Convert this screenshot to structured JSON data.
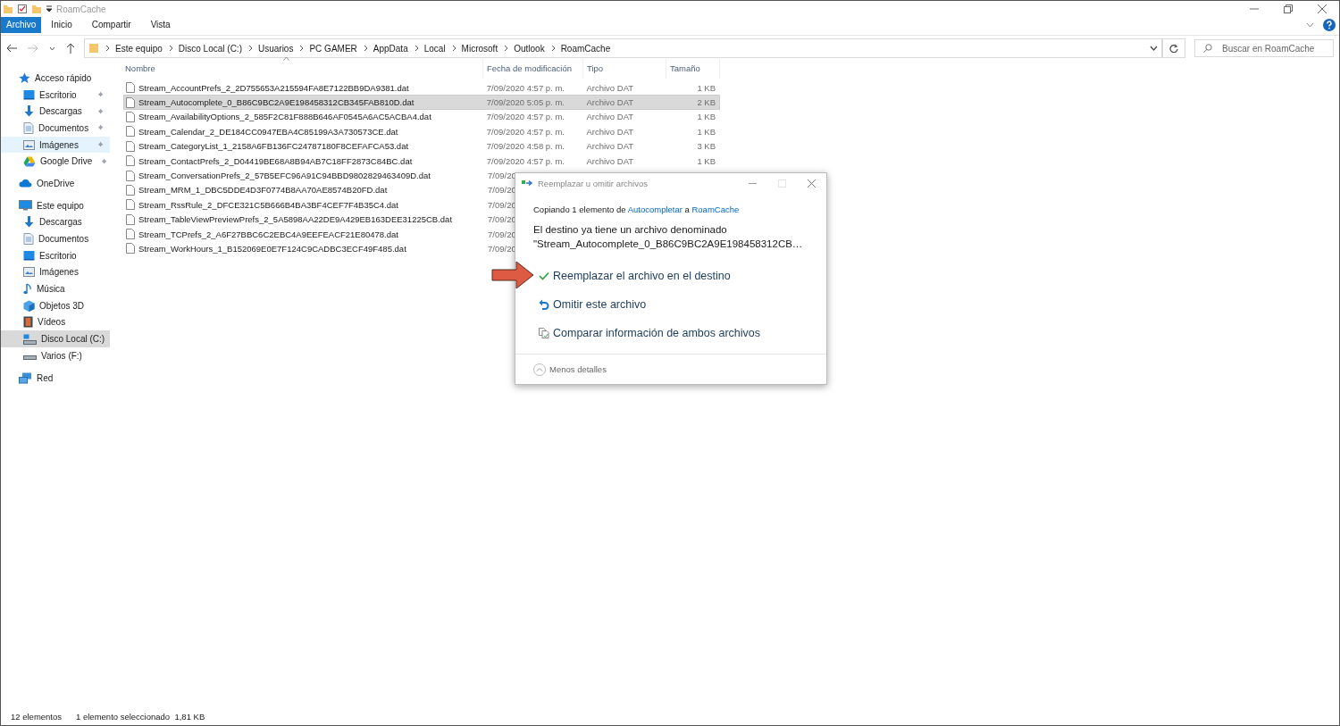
{
  "window": {
    "title": "RoamCache"
  },
  "ribbon": {
    "tabs": [
      {
        "label": "Archivo",
        "selected": true
      },
      {
        "label": "Inicio",
        "selected": false
      },
      {
        "label": "Compartir",
        "selected": false
      },
      {
        "label": "Vista",
        "selected": false
      }
    ]
  },
  "address": {
    "crumbs": [
      "Este equipo",
      "Disco Local (C:)",
      "Usuarios",
      "PC GAMER",
      "AppData",
      "Local",
      "Microsoft",
      "Outlook",
      "RoamCache"
    ],
    "search_placeholder": "Buscar en RoamCache"
  },
  "sidebar": {
    "items": [
      {
        "label": "Acceso rápido",
        "kind": "star",
        "selected": false,
        "hovered": false,
        "children": [
          {
            "label": "Escritorio",
            "kind": "desktop",
            "selected": false,
            "hovered": false,
            "pinned": true
          },
          {
            "label": "Descargas",
            "kind": "download",
            "selected": false,
            "hovered": false,
            "pinned": true
          },
          {
            "label": "Documentos",
            "kind": "document",
            "selected": false,
            "hovered": false,
            "pinned": true
          },
          {
            "label": "Imágenes",
            "kind": "pictures",
            "selected": false,
            "hovered": true,
            "pinned": true
          },
          {
            "label": "Google Drive",
            "kind": "gdrive",
            "selected": false,
            "hovered": false,
            "pinned": true
          }
        ]
      },
      {
        "label": "OneDrive",
        "kind": "cloud",
        "selected": false,
        "hovered": false
      },
      {
        "label": "Este equipo",
        "kind": "computer",
        "selected": false,
        "hovered": false,
        "children": [
          {
            "label": "Descargas",
            "kind": "download",
            "selected": false,
            "hovered": false
          },
          {
            "label": "Documentos",
            "kind": "document",
            "selected": false,
            "hovered": false
          },
          {
            "label": "Escritorio",
            "kind": "desktop",
            "selected": false,
            "hovered": false
          },
          {
            "label": "Imágenes",
            "kind": "pictures",
            "selected": false,
            "hovered": false
          },
          {
            "label": "Música",
            "kind": "music",
            "selected": false,
            "hovered": false
          },
          {
            "label": "Objetos 3D",
            "kind": "cube",
            "selected": false,
            "hovered": false
          },
          {
            "label": "Vídeos",
            "kind": "video",
            "selected": false,
            "hovered": false
          },
          {
            "label": "Disco Local (C:)",
            "kind": "disk",
            "selected": true,
            "hovered": false
          },
          {
            "label": "Varios (F:)",
            "kind": "drive",
            "selected": false,
            "hovered": false
          }
        ]
      },
      {
        "label": "Red",
        "kind": "network",
        "selected": false,
        "hovered": false
      }
    ]
  },
  "file_list": {
    "columns": [
      "Nombre",
      "Fecha de modificación",
      "Tipo",
      "Tamaño"
    ],
    "rows": [
      {
        "name": "Stream_AccountPrefs_2_2D755653A215594FA8E7122BB9DA9381.dat",
        "date": "7/09/2020 4:57 p. m.",
        "type": "Archivo DAT",
        "size": "1 KB",
        "selected": false
      },
      {
        "name": "Stream_Autocomplete_0_B86C9BC2A9E198458312CB345FAB810D.dat",
        "date": "7/09/2020 5:05 p. m.",
        "type": "Archivo DAT",
        "size": "2 KB",
        "selected": true
      },
      {
        "name": "Stream_AvailabilityOptions_2_585F2C81F888B646AF0545A6AC5ACBA4.dat",
        "date": "7/09/2020 4:57 p. m.",
        "type": "Archivo DAT",
        "size": "1 KB",
        "selected": false
      },
      {
        "name": "Stream_Calendar_2_DE184CC0947EBA4C85199A3A730573CE.dat",
        "date": "7/09/2020 4:57 p. m.",
        "type": "Archivo DAT",
        "size": "1 KB",
        "selected": false
      },
      {
        "name": "Stream_CategoryList_1_2158A6FB136FC24787180F8CEFAFCA53.dat",
        "date": "7/09/2020 4:58 p. m.",
        "type": "Archivo DAT",
        "size": "3 KB",
        "selected": false
      },
      {
        "name": "Stream_ContactPrefs_2_D04419BE68A8B94AB7C18FF2873C84BC.dat",
        "date": "7/09/2020 4:57 p. m.",
        "type": "Archivo DAT",
        "size": "1 KB",
        "selected": false
      },
      {
        "name": "Stream_ConversationPrefs_2_57B5EFC96A91C94BBD9802829463409D.dat",
        "date": "7/09/20",
        "selected": false
      },
      {
        "name": "Stream_MRM_1_DBC5DDE4D3F0774B8AA70AE8574B20FD.dat",
        "date": "7/09/20",
        "selected": false
      },
      {
        "name": "Stream_RssRule_2_DFCE321C5B666B4BA3BF4CEF7F4B35C4.dat",
        "date": "7/09/20",
        "selected": false
      },
      {
        "name": "Stream_TableViewPreviewPrefs_2_5A5898AA22DE9A429EB163DEE31225CB.dat",
        "date": "7/09/20",
        "selected": false
      },
      {
        "name": "Stream_TCPrefs_2_A6F27BBC6C2EBC4A9EEFEACF21E80478.dat",
        "date": "7/09/20",
        "selected": false
      },
      {
        "name": "Stream_WorkHours_1_B152069E0E7F124C9CADBC3ECF49F485.dat",
        "date": "7/09/20",
        "selected": false
      }
    ]
  },
  "status_bar": {
    "count": "12 elementos",
    "selection": "1 elemento seleccionado  1,81 KB"
  },
  "dialog": {
    "title": "Reemplazar u omitir archivos",
    "copying": {
      "prefix": "Copiando 1 elemento de",
      "source": "Autocompletar",
      "middle": "a",
      "target": "RoamCache"
    },
    "message": [
      "El destino ya tiene un archivo denominado",
      "\"Stream_Autocomplete_0_B86C9BC2A9E198458312CB…"
    ],
    "options": [
      {
        "kind": "check",
        "label": "Reemplazar el archivo en el destino"
      },
      {
        "kind": "undo",
        "label": "Omitir este archivo"
      },
      {
        "kind": "compare",
        "label": "Comparar información de ambos archivos"
      }
    ],
    "details_toggle": "Menos detalles"
  }
}
